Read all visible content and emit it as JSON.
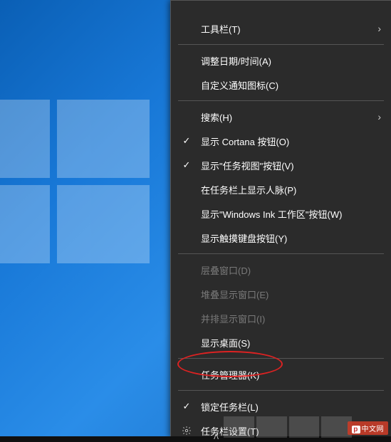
{
  "menu": {
    "toolbars": "工具栏(T)",
    "adjust_date_time": "调整日期/时间(A)",
    "customize_notification_icons": "自定义通知图标(C)",
    "search": "搜索(H)",
    "show_cortana_button": "显示 Cortana 按钮(O)",
    "show_task_view_button": "显示\"任务视图\"按钮(V)",
    "show_people_on_taskbar": "在任务栏上显示人脉(P)",
    "show_windows_ink_workspace_button": "显示\"Windows Ink 工作区\"按钮(W)",
    "show_touch_keyboard_button": "显示触摸键盘按钮(Y)",
    "cascade_windows": "层叠窗口(D)",
    "stack_windows": "堆叠显示窗口(E)",
    "side_by_side_windows": "并排显示窗口(I)",
    "show_desktop": "显示桌面(S)",
    "task_manager": "任务管理器(K)",
    "lock_taskbar": "锁定任务栏(L)",
    "taskbar_settings": "任务栏设置(T)"
  },
  "watermark": "中文网"
}
